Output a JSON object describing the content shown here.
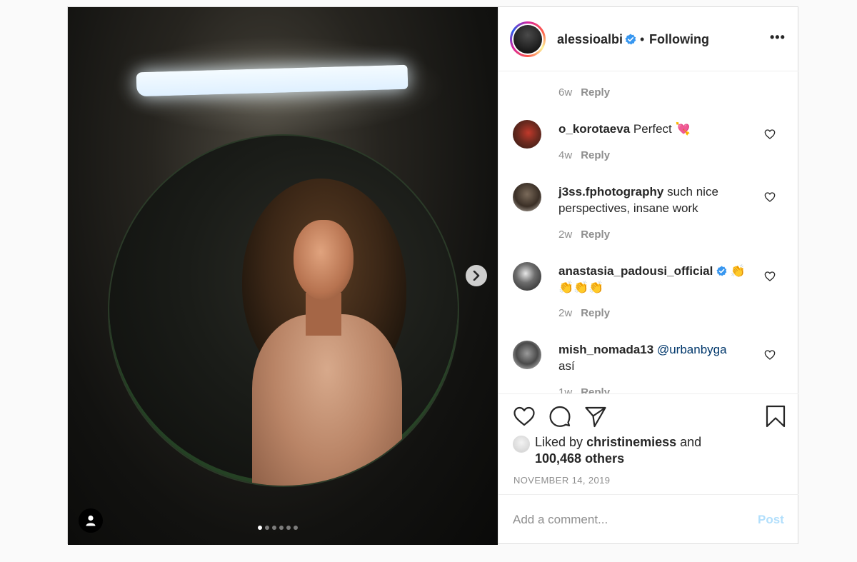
{
  "post": {
    "author": "alessioalbi",
    "separator": "•",
    "follow_status": "Following",
    "more_label": "•••",
    "carousel": {
      "total_slides": 6,
      "active_slide": 1
    }
  },
  "comments": {
    "top_meta": {
      "time": "6w",
      "reply_label": "Reply"
    },
    "items": [
      {
        "username": "o_korotaeva",
        "text": "Perfect 💘",
        "time": "4w",
        "reply_label": "Reply"
      },
      {
        "username": "j3ss.fphotography",
        "text": "such nice perspectives, insane work",
        "time": "2w",
        "reply_label": "Reply"
      },
      {
        "username": "anastasia_padousi_official",
        "text": "👏👏👏👏",
        "time": "2w",
        "reply_label": "Reply"
      },
      {
        "username": "mish_nomada13",
        "mention": "@urbanbyga",
        "text": "así",
        "time": "1w",
        "reply_label": "Reply"
      }
    ]
  },
  "likes": {
    "prefix": "Liked by",
    "liker": "christinemiess",
    "conj": "and",
    "others": "100,468 others"
  },
  "date": "NOVEMBER 14, 2019",
  "add_comment": {
    "placeholder": "Add a comment...",
    "post_label": "Post"
  },
  "colors": {
    "accent": "#0095f6",
    "post_disabled": "#b2dffc",
    "verified": "#3897f0"
  },
  "icons": [
    "chevron-right-icon",
    "user-tag-icon",
    "verified-icon",
    "more-icon",
    "heart-icon",
    "comment-icon",
    "share-icon",
    "bookmark-icon"
  ]
}
